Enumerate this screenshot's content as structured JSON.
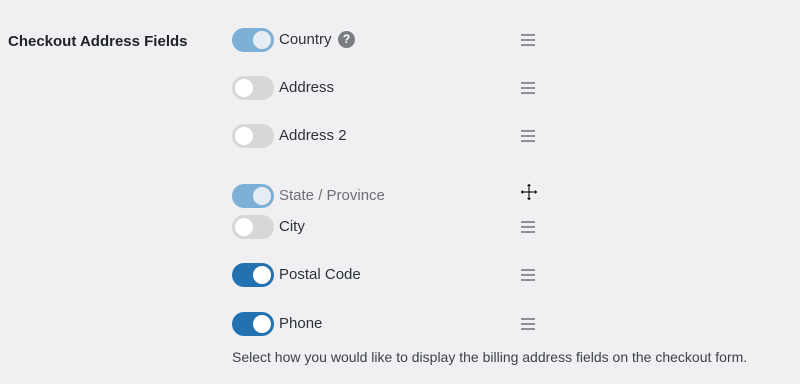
{
  "section": {
    "label": "Checkout Address Fields"
  },
  "fields": [
    {
      "label": "Country",
      "state": "enabled",
      "help": "?"
    },
    {
      "label": "Address",
      "state": "disabled"
    },
    {
      "label": "Address 2",
      "state": "disabled"
    },
    {
      "label": "State / Province",
      "state": "enabled (dragging)"
    },
    {
      "label": "City",
      "state": "disabled"
    },
    {
      "label": "Postal Code",
      "state": "enabled"
    },
    {
      "label": "Phone",
      "state": "enabled"
    }
  ],
  "description": "Select how you would like to display the billing address fields on the checkout form.",
  "colors": {
    "toggle_on": "#2271b1",
    "toggle_off": "#d7d6d9",
    "background": "#f0eff1"
  },
  "icons": {
    "help": "help-circle-icon",
    "drag": "drag-handle-icon",
    "cursor": "move-cursor-icon"
  }
}
